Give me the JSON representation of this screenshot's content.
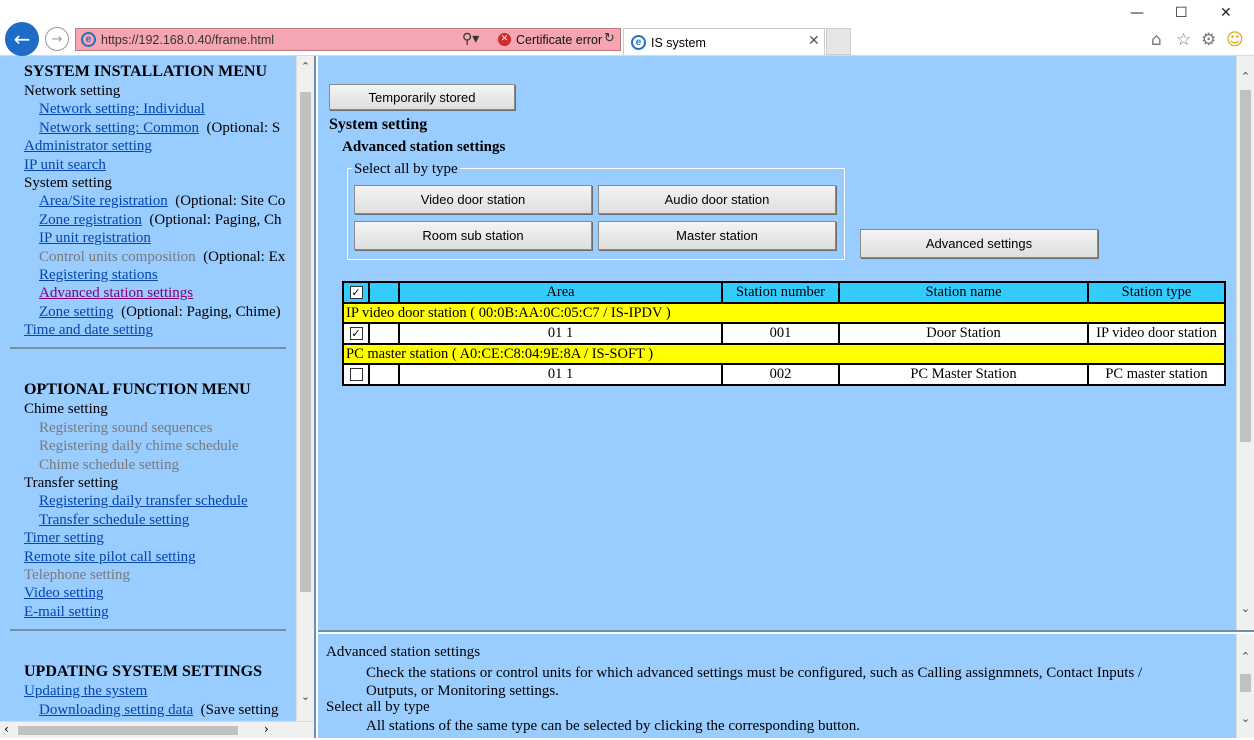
{
  "browser": {
    "back_icon": "back-arrow-icon",
    "forward_icon": "forward-arrow-icon",
    "url": "https://192.168.0.40/frame.html",
    "cert_error": "Certificate error",
    "tab_title": "IS system",
    "address_bar_color": "#f5a6b2"
  },
  "sidebar": {
    "section1_title": "SYSTEM INSTALLATION MENU",
    "network_setting": "Network setting",
    "network_individual": "Network setting: Individual",
    "network_common": "Network setting: Common",
    "network_common_note": "(Optional: S",
    "administrator_setting": "Administrator setting",
    "ip_unit_search": "IP unit search",
    "system_setting": "System setting",
    "area_site_registration": "Area/Site registration",
    "area_site_note": "(Optional: Site Co",
    "zone_registration": "Zone registration",
    "zone_registration_note": "(Optional: Paging, Ch",
    "ip_unit_registration": "IP unit registration",
    "control_units_composition": "Control units composition",
    "control_units_note": "(Optional: Ex",
    "registering_stations": "Registering stations",
    "advanced_station_settings": "Advanced station settings",
    "zone_setting": "Zone setting",
    "zone_setting_note": "(Optional: Paging, Chime)",
    "time_and_date_setting": "Time and date setting",
    "section2_title": "OPTIONAL FUNCTION MENU",
    "chime_setting": "Chime setting",
    "registering_sound_sequences": "Registering sound sequences",
    "registering_daily_chime_schedule": "Registering daily chime schedule",
    "chime_schedule_setting": "Chime schedule setting",
    "transfer_setting": "Transfer setting",
    "registering_daily_transfer_schedule": "Registering daily transfer schedule",
    "transfer_schedule_setting": "Transfer schedule setting",
    "timer_setting": "Timer setting",
    "remote_site_pilot_call_setting": "Remote site pilot call setting",
    "telephone_setting": "Telephone setting",
    "video_setting": "Video setting",
    "email_setting": "E-mail setting",
    "section3_title": "UPDATING SYSTEM SETTINGS",
    "updating_the_system": "Updating the system",
    "downloading_setting_data": "Downloading setting data",
    "downloading_note": "(Save setting"
  },
  "main": {
    "temporarily_stored": "Temporarily stored",
    "system_setting_heading": "System setting",
    "advanced_heading": "Advanced station settings",
    "select_all_legend": "Select all by type",
    "btn_video_door": "Video door station",
    "btn_audio_door": "Audio door station",
    "btn_room_sub": "Room sub station",
    "btn_master": "Master station",
    "btn_advanced": "Advanced settings",
    "table": {
      "headers": [
        "Area",
        "Station number",
        "Station name",
        "Station type"
      ],
      "group1": "IP video door station ( 00:0B:AA:0C:05:C7 / IS-IPDV )",
      "row1": {
        "checked": true,
        "area": "01 1",
        "number": "001",
        "name": "Door Station",
        "type": "IP video door station"
      },
      "group2": "PC master station ( A0:CE:C8:04:9E:8A / IS-SOFT )",
      "row2": {
        "checked": false,
        "area": "01 1",
        "number": "002",
        "name": "PC Master Station",
        "type": "PC master station"
      },
      "header_color": "#33ccff",
      "group_color": "#ffff00"
    }
  },
  "help": {
    "title1": "Advanced station settings",
    "text1a": "Check the stations or control units for which advanced settings must be configured, such as Calling assignmnets, Contact Inputs /",
    "text1b": "Outputs, or Monitoring settings.",
    "title2": "Select all by type",
    "text2": "All stations of the same type can be selected by clicking the corresponding button."
  },
  "colors": {
    "frame_bg": "#99ccff",
    "link": "#0645ad",
    "visited_link": "#800080"
  }
}
